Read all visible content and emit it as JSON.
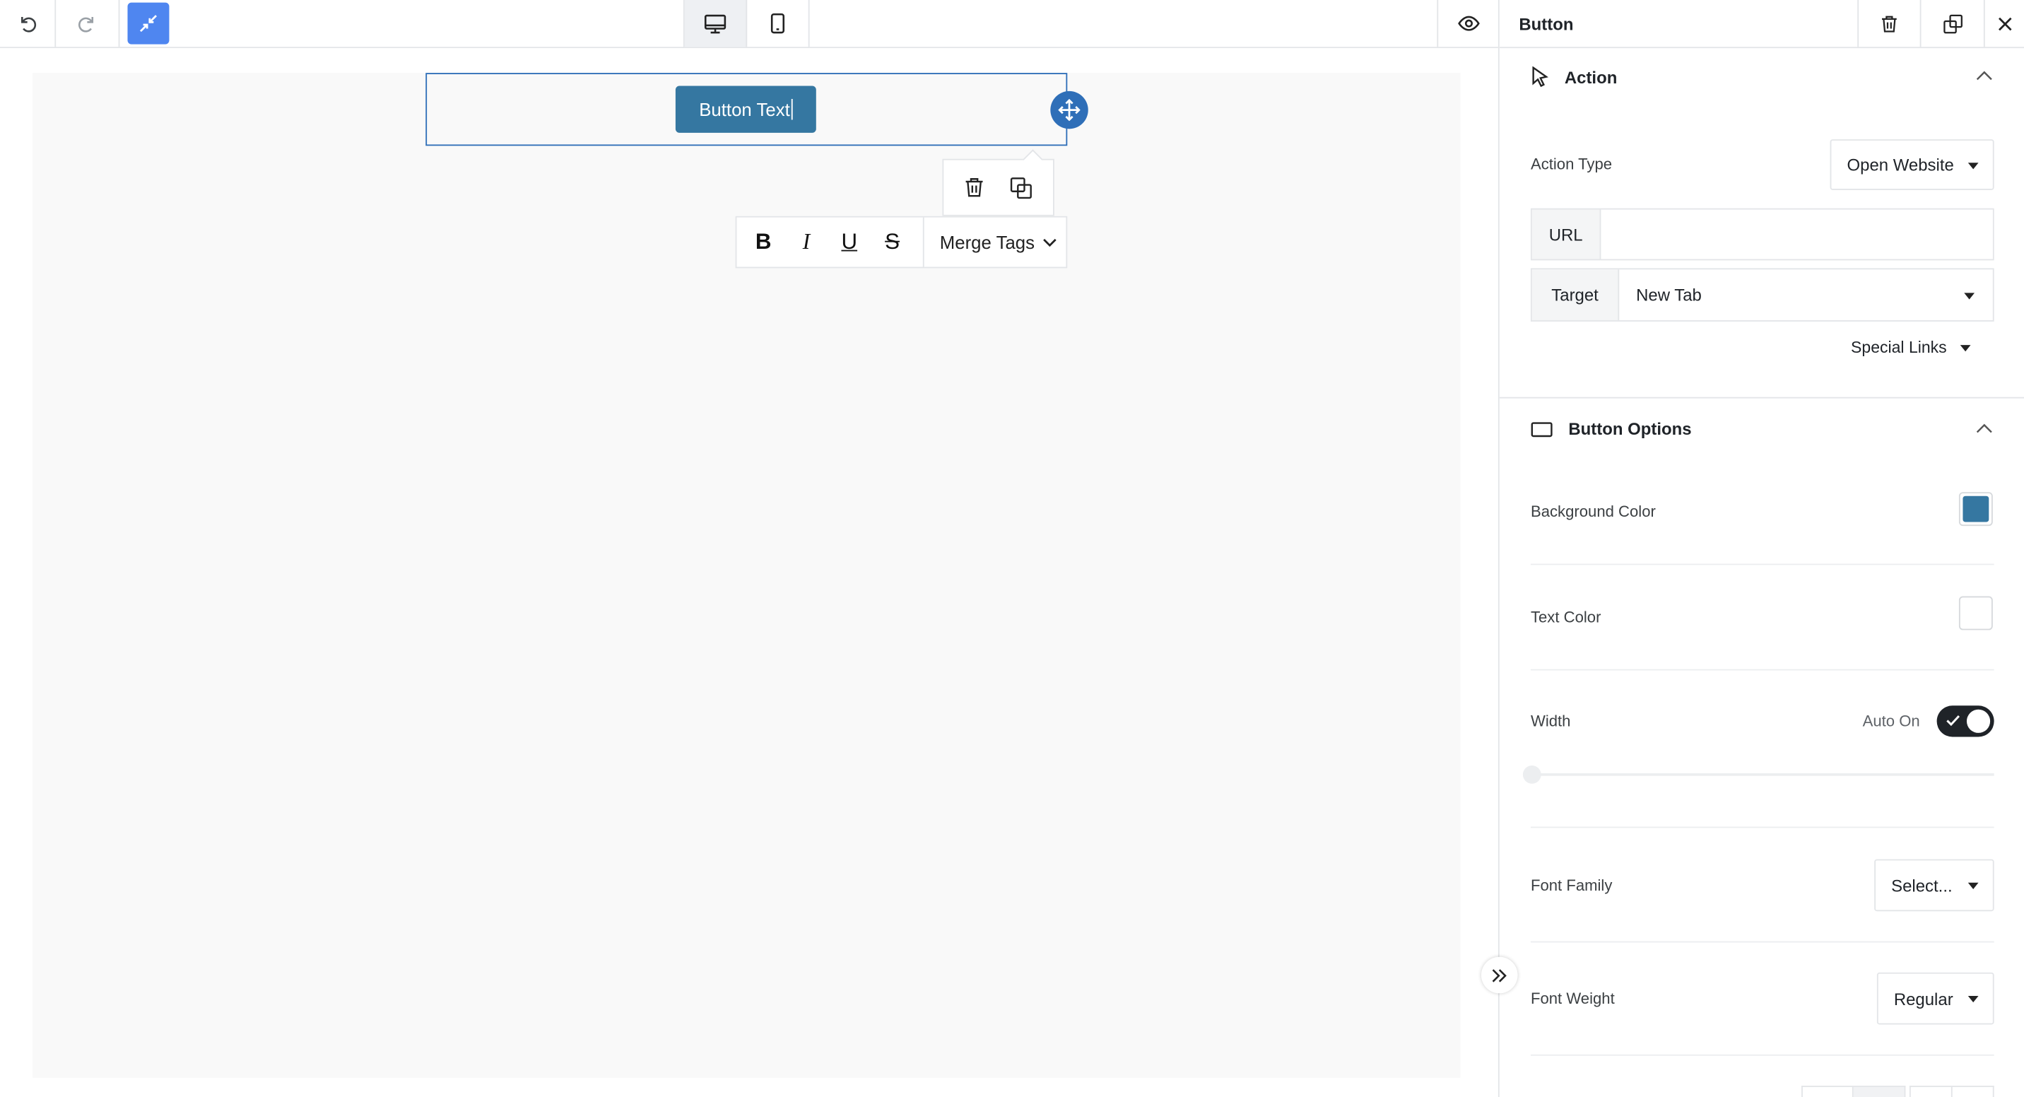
{
  "toolbar": {
    "undo_icon": "undo-icon",
    "redo_icon": "redo-icon",
    "collapse_icon": "collapse-icon",
    "devices": [
      "desktop",
      "mobile"
    ],
    "active_device": "desktop",
    "preview_icon": "eye-icon"
  },
  "canvas": {
    "button_text": "Button Text",
    "format_toolbar": {
      "bold": "B",
      "italic": "I",
      "underline": "U",
      "strike": "S",
      "merge_tags_label": "Merge Tags"
    }
  },
  "panel": {
    "title": "Button",
    "action_section": {
      "title": "Action",
      "action_type_label": "Action Type",
      "action_type_value": "Open Website",
      "url_label": "URL",
      "url_value": "",
      "target_label": "Target",
      "target_value": "New Tab",
      "special_links_label": "Special Links"
    },
    "button_options": {
      "title": "Button Options",
      "background_color_label": "Background Color",
      "background_color": "#3577a1",
      "text_color_label": "Text Color",
      "text_color": "#ffffff",
      "width_label": "Width",
      "auto_label": "Auto On",
      "auto_enabled": true,
      "width_slider_value": 0,
      "font_family_label": "Font Family",
      "font_family_value": "Select...",
      "font_weight_label": "Font Weight",
      "font_weight_value": "Regular"
    }
  },
  "colors": {
    "accent": "#2f6fb8",
    "collapse_button": "#4f86f0",
    "button_bg": "#3577a1"
  }
}
